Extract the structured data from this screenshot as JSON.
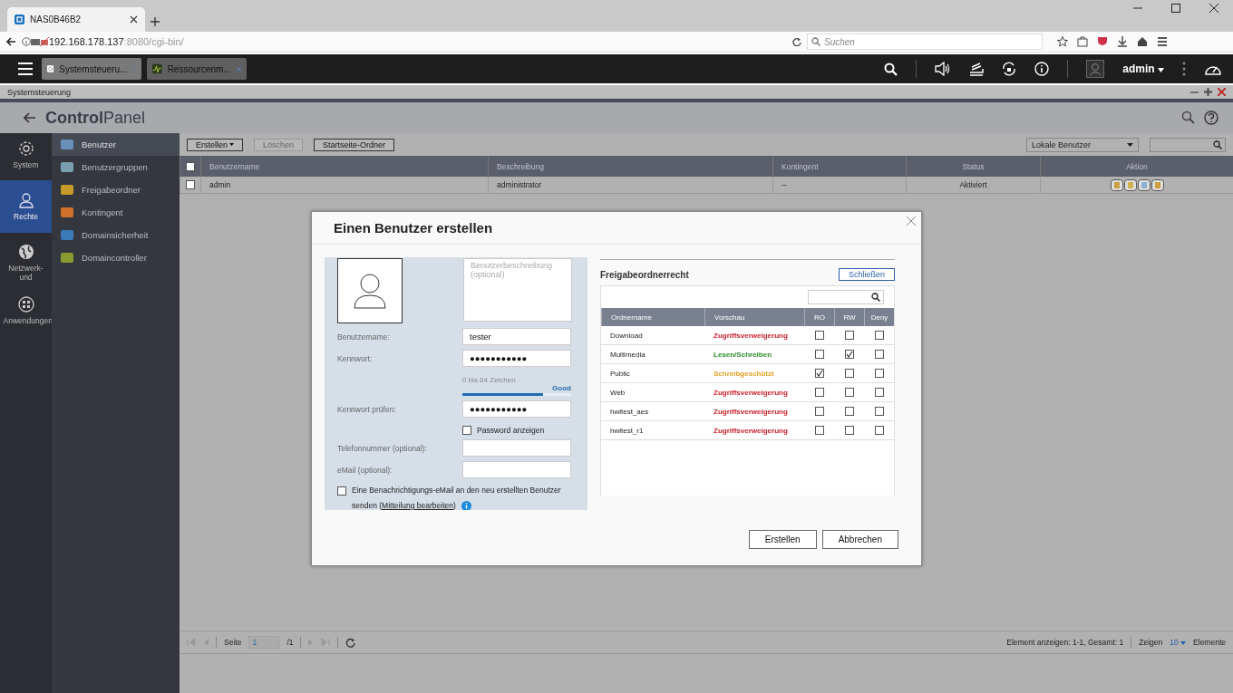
{
  "browser": {
    "tab_title": "NAS0B46B2",
    "url_host": "192.168.178.137",
    "url_rest": ":8080/cgi-bin/",
    "search_placeholder": "Suchen"
  },
  "app_bar": {
    "tabs": [
      {
        "label": "Systemsteueru...",
        "selected": true,
        "kind": "gear"
      },
      {
        "label": "Ressourcenm...",
        "selected": false,
        "kind": "monitor"
      }
    ],
    "user": "admin"
  },
  "window_title": "Systemsteuerung",
  "header": {
    "title": "**Control**Panel"
  },
  "rail": [
    {
      "label": "System",
      "selected": false,
      "kind": "gear"
    },
    {
      "label": "Rechte",
      "selected": true,
      "kind": "user"
    },
    {
      "label": "Netzwerk- und",
      "selected": false,
      "kind": "globe"
    },
    {
      "label": "Anwendungen",
      "selected": false,
      "kind": "apps"
    }
  ],
  "menu": [
    {
      "label": "Benutzer",
      "selected": true,
      "color": "#6a8fb8"
    },
    {
      "label": "Benutzergruppen",
      "selected": false,
      "color": "#7aa0b0"
    },
    {
      "label": "Freigabeordner",
      "selected": false,
      "color": "#c89a2a"
    },
    {
      "label": "Kontingent",
      "selected": false,
      "color": "#d0702a"
    },
    {
      "label": "Domainsicherheit",
      "selected": false,
      "color": "#3a7ab8"
    },
    {
      "label": "Domaincontroller",
      "selected": false,
      "color": "#8a9a30"
    }
  ],
  "toolbar": [
    {
      "label": "Erstellen",
      "kind": "dropdown",
      "disabled": false
    },
    {
      "label": "Löschen",
      "kind": "button",
      "disabled": true
    },
    {
      "label": "Startseite-Ordner",
      "kind": "button",
      "disabled": false
    }
  ],
  "filter": {
    "value": "Lokale Benutzer"
  },
  "table": {
    "select_all_checked": false,
    "columns": [
      "Benutzername",
      "Beschreibung",
      "Kontingent",
      "Status",
      "Aktion"
    ],
    "rows": [
      {
        "checked": false,
        "cells": [
          "admin",
          "administrator",
          "--",
          "Aktiviert"
        ]
      }
    ]
  },
  "pager": {
    "page_label": "Seite",
    "page": "1",
    "total": "/1",
    "info": "Element anzeigen: 1-1, Gesamt: 1",
    "show_label": "Zeigen",
    "per_page": "10",
    "items_label": "Elemente"
  },
  "dialog": {
    "title": "Einen Benutzer erstellen",
    "description_placeholder": "Benutzerbeschreibung (optional)",
    "form": [
      {
        "kind": "field",
        "label": "Benutzername:",
        "value": "tester"
      },
      {
        "kind": "field",
        "label": "Kennwort:",
        "value": "●●●●●●●●●●●"
      },
      {
        "kind": "strength",
        "hint": "0 bis 64 Zeichen",
        "label": "Good",
        "level": 0.74
      },
      {
        "kind": "field",
        "label": "Kennwort prüfen:",
        "value": "●●●●●●●●●●●"
      },
      {
        "kind": "checkbox",
        "label": "Password anzeigen",
        "checked": false
      },
      {
        "kind": "field",
        "label": "Telefonnummer (optional):"
      },
      {
        "kind": "field",
        "label": "eMail (optional):"
      }
    ],
    "notify": {
      "checked": false,
      "text": "Eine Benachrichtigungs-eMail an den neu erstellten Benutzer senden (",
      "link": "Mitteilung bearbeiten",
      "text_after": ")"
    },
    "share": {
      "title": "Freigabeordnerrecht",
      "close_button": "Schließen",
      "columns": [
        "Ordnername",
        "Vorschau",
        "RO",
        "RW",
        "Deny"
      ],
      "rows": [
        {
          "name": "Download",
          "preview": "Zugriffsverweigerung",
          "color": "#c8202a",
          "ro": false,
          "rw": false,
          "deny": false
        },
        {
          "name": "Multimedia",
          "preview": "Lesen/Schreiben",
          "color": "#2a8a2a",
          "ro": false,
          "rw": true,
          "deny": false
        },
        {
          "name": "Public",
          "preview": "Schreibgeschützt",
          "color": "#e3a020",
          "ro": true,
          "rw": false,
          "deny": false
        },
        {
          "name": "Web",
          "preview": "Zugriffsverweigerung",
          "color": "#c8202a",
          "ro": false,
          "rw": false,
          "deny": false
        },
        {
          "name": "hwltest_aes",
          "preview": "Zugriffsverweigerung",
          "color": "#c8202a",
          "ro": false,
          "rw": false,
          "deny": false
        },
        {
          "name": "hwltest_r1",
          "preview": "Zugriffsverweigerung",
          "color": "#c8202a",
          "ro": false,
          "rw": false,
          "deny": false
        }
      ]
    },
    "buttons": [
      "Erstellen",
      "Abbrechen"
    ]
  }
}
